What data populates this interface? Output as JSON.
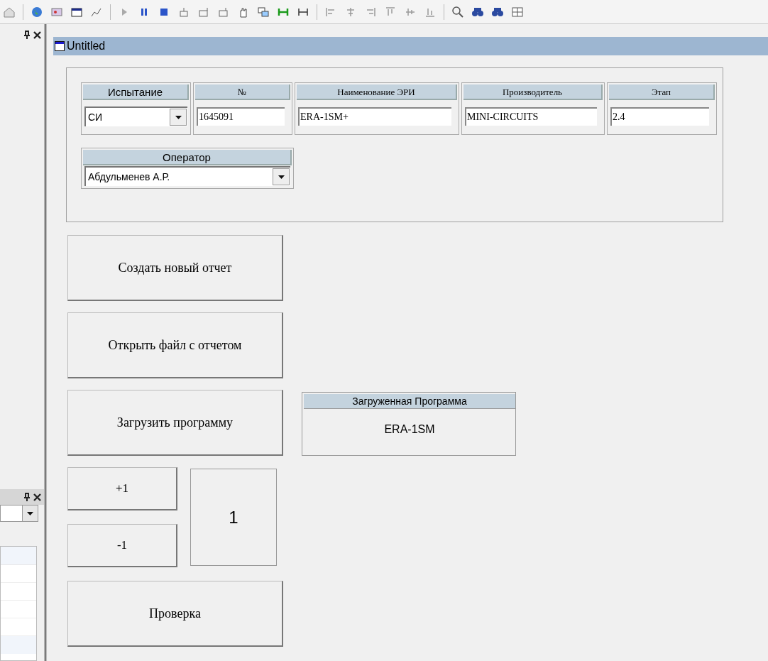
{
  "document": {
    "title": "Untitled"
  },
  "fields": [
    {
      "label": "Испытание",
      "kind": "combo",
      "value": "СИ"
    },
    {
      "label": "№",
      "kind": "text",
      "value": "1645091"
    },
    {
      "label": "Наименование ЭРИ",
      "kind": "text",
      "value": "ERA-1SM+"
    },
    {
      "label": "Производитель",
      "kind": "text",
      "value": "MINI-CIRCUITS"
    },
    {
      "label": "Этап",
      "kind": "text",
      "value": "2.4"
    }
  ],
  "operator": {
    "label": "Оператор",
    "kind": "combo",
    "value": "Абдульменев А.Р."
  },
  "buttons": [
    "Создать новый отчет",
    "Открыть файл с отчетом",
    "Загрузить программу"
  ],
  "loaded_program": {
    "label": "Загруженная Программа",
    "value": "ERA-1SM"
  },
  "counter": {
    "increment": "+1",
    "decrement": "-1",
    "value": "1"
  },
  "check_button": "Проверка"
}
